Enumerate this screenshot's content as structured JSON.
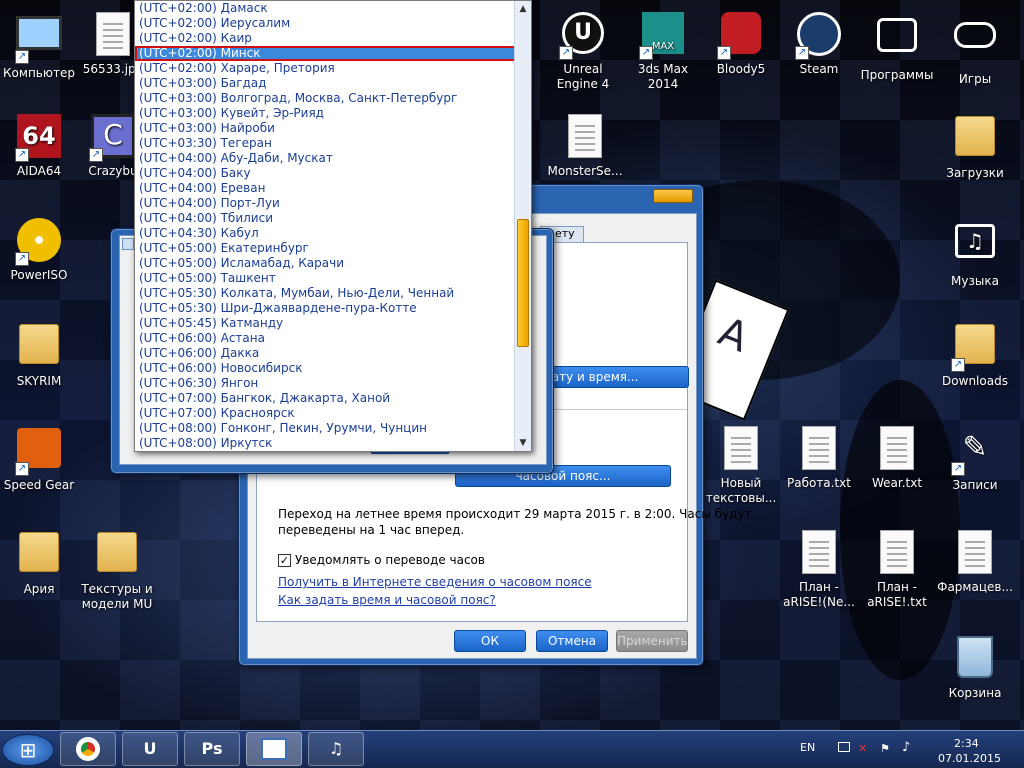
{
  "desktop": {
    "icons": [
      {
        "label": "Компьютер",
        "icon": "computer-icon"
      },
      {
        "label": "56533.jpg",
        "icon": "image-file-icon"
      },
      {
        "label": "Unreal Engine 4",
        "icon": "unreal-engine-icon"
      },
      {
        "label": "3ds Max 2014",
        "icon": "3dsmax-icon"
      },
      {
        "label": "Bloody5",
        "icon": "bloody-hand-icon"
      },
      {
        "label": "Steam",
        "icon": "steam-icon"
      },
      {
        "label": "Программы",
        "icon": "folder-box-icon"
      },
      {
        "label": "Игры",
        "icon": "gamepad-icon"
      },
      {
        "label": "AIDA64",
        "icon": "aida64-icon"
      },
      {
        "label": "Crazybu",
        "icon": "crazybump-icon"
      },
      {
        "label": "MonsterSe...",
        "icon": "text-file-icon"
      },
      {
        "label": "Загрузки",
        "icon": "downloads-folder-icon"
      },
      {
        "label": "PowerISO",
        "icon": "poweriso-icon"
      },
      {
        "label": "Музыка",
        "icon": "music-folder-icon"
      },
      {
        "label": "SKYRIM",
        "icon": "folder-icon"
      },
      {
        "label": "Downloads",
        "icon": "folder-icon"
      },
      {
        "label": "Speed Gear",
        "icon": "speed-gear-icon"
      },
      {
        "label": "Новый текстовы...",
        "icon": "text-file-icon"
      },
      {
        "label": "Работа.txt",
        "icon": "text-file-icon"
      },
      {
        "label": "Wear.txt",
        "icon": "text-file-icon"
      },
      {
        "label": "Записи",
        "icon": "pen-icon"
      },
      {
        "label": "Ария",
        "icon": "folder-icon"
      },
      {
        "label": "Текстуры и модели MU",
        "icon": "folder-icon"
      },
      {
        "label": "План - aRISE!(Ne...",
        "icon": "text-file-icon"
      },
      {
        "label": "План - aRISE!.txt",
        "icon": "text-file-icon"
      },
      {
        "label": "Фармацев...",
        "icon": "text-file-icon"
      },
      {
        "label": "Корзина",
        "icon": "recycle-bin-icon"
      }
    ]
  },
  "datetime_dialog": {
    "tab_partial": "ету",
    "change_datetime_button": "ть дату и время...",
    "change_timezone_button": "часовой пояс...",
    "dst_info": "Переход на летнее время происходит 29 марта 2015 г. в 2:00. Часы будут",
    "dst_info_2": "переведены на 1 час вперед.",
    "notify_checkbox_label": "Уведомлять о переводе часов",
    "notify_checked": true,
    "link_online_info": "Получить в Интернете сведения о часовом поясе",
    "link_howto": "Как задать время и часовой пояс?",
    "ok_label": "ОК",
    "cancel_label": "Отмена",
    "apply_label": "Применить"
  },
  "timezone_list": {
    "items": [
      "(UTC+02:00) Дамаск",
      "(UTC+02:00) Иерусалим",
      "(UTC+02:00) Каир",
      "(UTC+02:00) Минск",
      "(UTC+02:00) Хараре, Претория",
      "(UTC+03:00) Багдад",
      "(UTC+03:00) Волгоград, Москва, Санкт-Петербург",
      "(UTC+03:00) Кувейт, Эр-Рияд",
      "(UTC+03:00) Найроби",
      "(UTC+03:30) Тегеран",
      "(UTC+04:00) Абу-Даби, Мускат",
      "(UTC+04:00) Баку",
      "(UTC+04:00) Ереван",
      "(UTC+04:00) Порт-Луи",
      "(UTC+04:00) Тбилиси",
      "(UTC+04:30) Кабул",
      "(UTC+05:00) Екатеринбург",
      "(UTC+05:00) Исламабад, Карачи",
      "(UTC+05:00) Ташкент",
      "(UTC+05:30) Колката, Мумбаи, Нью-Дели, Ченнай",
      "(UTC+05:30) Шри-Джаявардене-пура-Котте",
      "(UTC+05:45) Катманду",
      "(UTC+06:00) Астана",
      "(UTC+06:00) Дакка",
      "(UTC+06:00) Новосибирск",
      "(UTC+06:30) Янгон",
      "(UTC+07:00) Бангкок, Джакарта, Ханой",
      "(UTC+07:00) Красноярск",
      "(UTC+08:00) Гонконг, Пекин, Урумчи, Чунцин",
      "(UTC+08:00) Иркутск"
    ],
    "selected_index": 3,
    "selected_highlight_color": "#3a89dd",
    "annotation_border_color": "#d01010"
  },
  "taskbar": {
    "start_icon": "windows-logo-icon",
    "apps": [
      {
        "icon": "chrome-icon",
        "label": ""
      },
      {
        "icon": "unreal-engine-icon",
        "label": "U"
      },
      {
        "icon": "photoshop-icon",
        "label": "Ps"
      },
      {
        "icon": "calendar-clock-icon",
        "label": ""
      },
      {
        "icon": "itunes-music-icon",
        "label": "♫"
      }
    ],
    "language": "EN",
    "time": "2:34",
    "date": "07.01.2015"
  },
  "colors": {
    "accent": "#2b64b0",
    "button": "#1c64c8",
    "scroll_thumb": "#f0a000"
  }
}
